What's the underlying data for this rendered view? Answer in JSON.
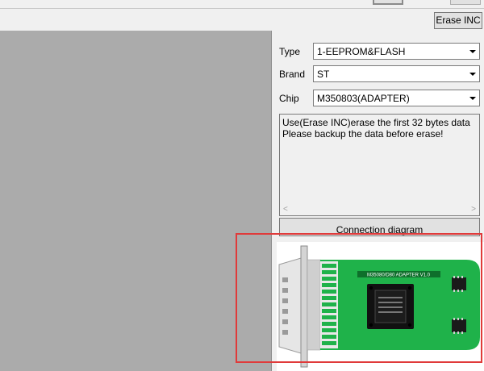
{
  "toolbar": {
    "erase_inc_label": "Erase INC"
  },
  "form": {
    "type_label": "Type",
    "type_value": "1-EEPROM&FLASH",
    "brand_label": "Brand",
    "brand_value": "ST",
    "chip_label": "Chip",
    "chip_value": "M350803(ADAPTER)"
  },
  "info": {
    "line1": "Use(Erase INC)erase the first 32 bytes data",
    "line2": "Please backup the data before erase!"
  },
  "connection_button_label": "Connection diagram",
  "diagram": {
    "adapter_label": "M35080/D80 ADAPTER V1.0",
    "board_color": "#1fb24a",
    "highlight_color": "#e03a3a"
  }
}
